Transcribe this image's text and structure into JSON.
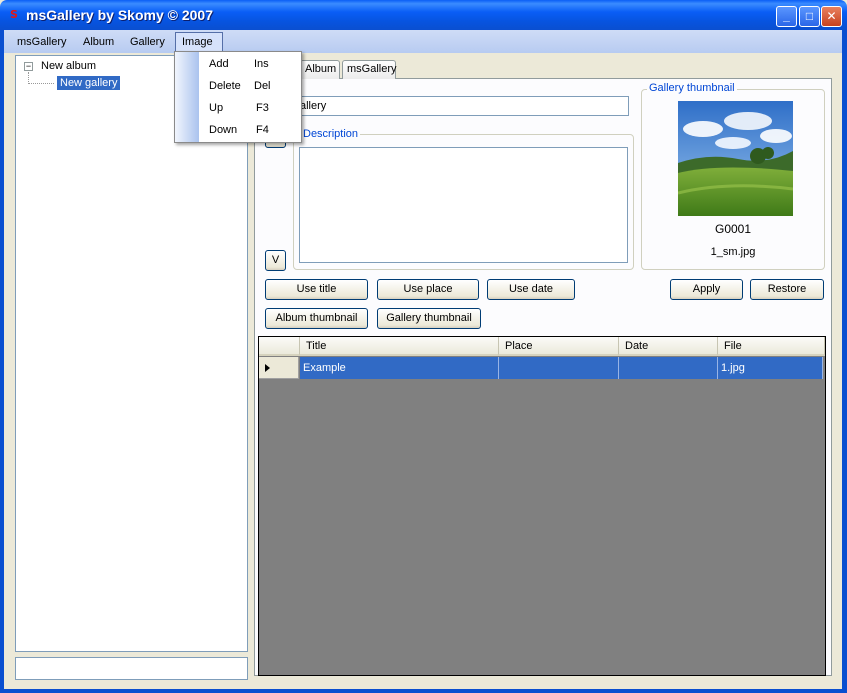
{
  "window": {
    "title": "msGallery by Skomy © 2007",
    "app_icon_glyph": "S",
    "minimize_glyph": "_",
    "maximize_glyph": "□",
    "close_glyph": "✕"
  },
  "menubar": [
    "msGallery",
    "Album",
    "Gallery",
    "Image"
  ],
  "image_menu": {
    "items": [
      {
        "label": "Add",
        "shortcut": "Ins"
      },
      {
        "label": "Delete",
        "shortcut": "Del"
      },
      {
        "label": "Up",
        "shortcut": "F3"
      },
      {
        "label": "Down",
        "shortcut": "F4"
      }
    ]
  },
  "tree": {
    "expander_glyph": "−",
    "album": "New album",
    "gallery": "New gallery"
  },
  "tabs": [
    "Album",
    "msGallery"
  ],
  "gallery_form": {
    "title_value": "allery",
    "description_legend": "Description",
    "description_value": "",
    "v_button": "V",
    "thumbnail_legend": "Gallery thumbnail",
    "thumbnail_name": "G0001",
    "thumbnail_file": "1_sm.jpg"
  },
  "buttons": {
    "use_title": "Use title",
    "use_place": "Use place",
    "use_date": "Use date",
    "apply": "Apply",
    "restore": "Restore",
    "album_thumbnail": "Album thumbnail",
    "gallery_thumbnail": "Gallery thumbnail"
  },
  "grid": {
    "columns": [
      "Title",
      "Place",
      "Date",
      "File"
    ],
    "rows": [
      {
        "title": "Example",
        "place": "",
        "date": "",
        "file": "1.jpg",
        "selected": true
      }
    ]
  },
  "status": {
    "value": ""
  },
  "colors": {
    "titlebar": "#0a5ef6",
    "selection": "#316ac5",
    "group_legend": "#0046d5"
  }
}
